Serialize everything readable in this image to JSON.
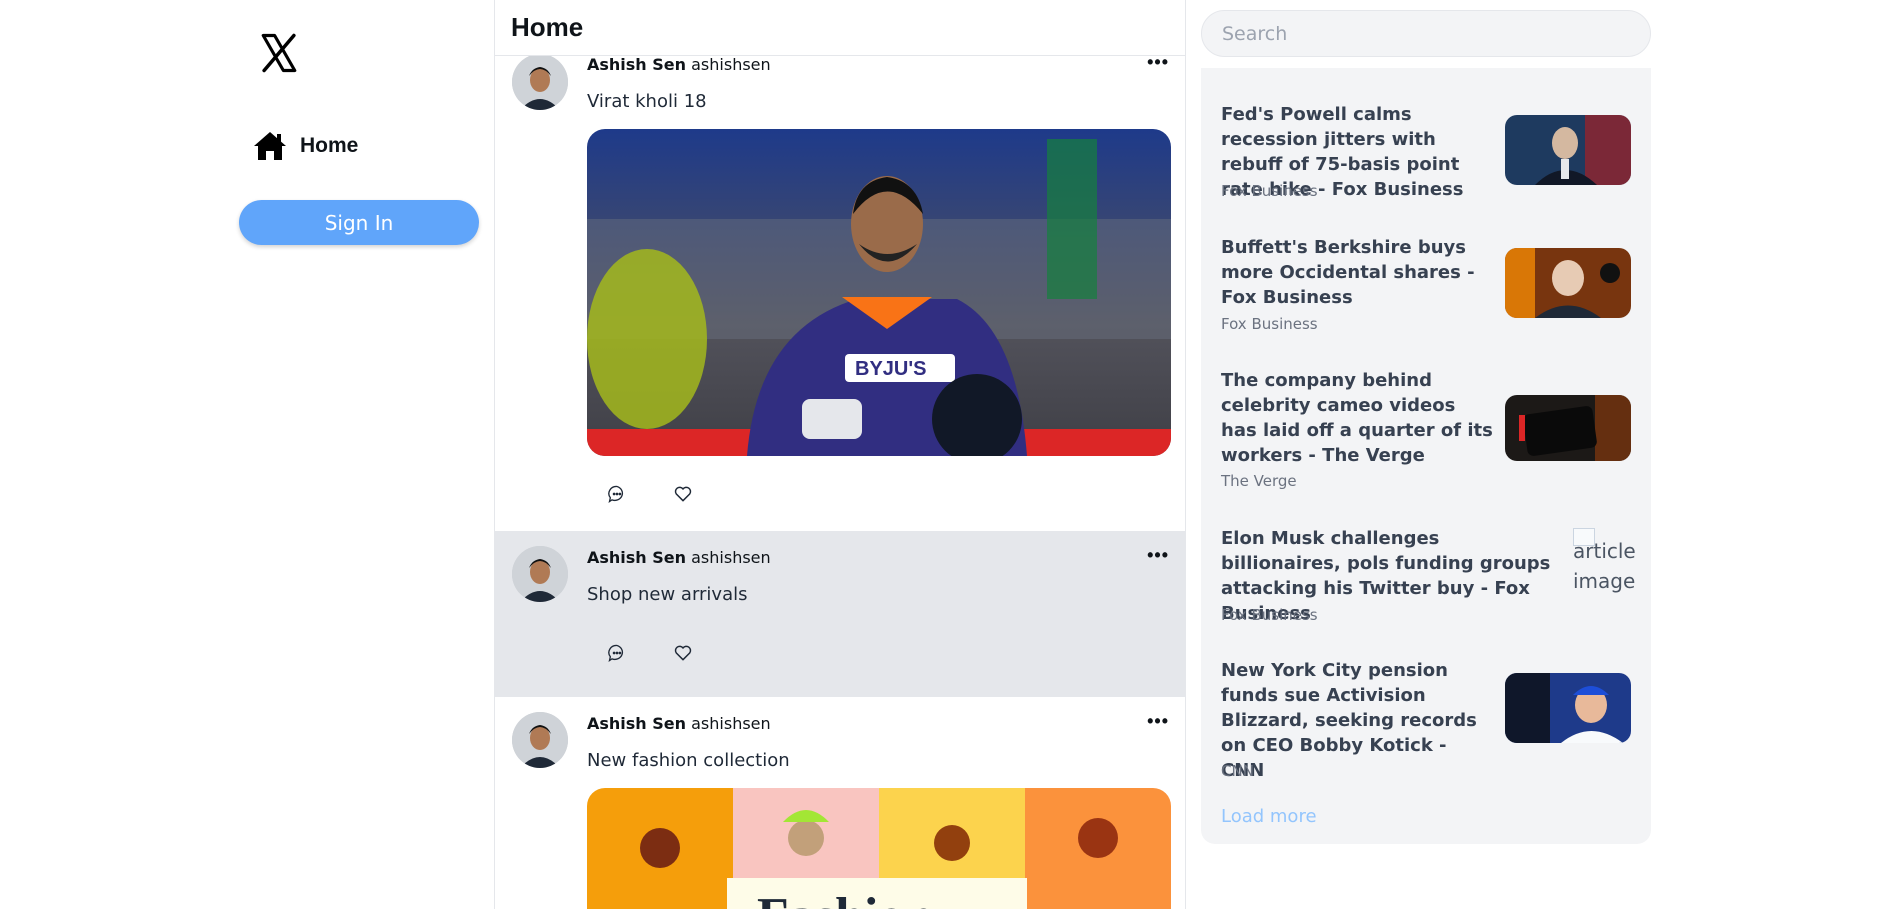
{
  "sidebar": {
    "logo_icon": "x-logo-icon",
    "home_label": "Home",
    "home_icon": "home-icon",
    "signin_label": "Sign In"
  },
  "feed": {
    "title": "Home",
    "tweets": [
      {
        "name": "Ashish Sen",
        "handle": "ashishsen",
        "text": "Virat kholi 18",
        "has_image": true,
        "image": "cricketer-photo"
      },
      {
        "name": "Ashish Sen",
        "handle": "ashishsen",
        "text": "Shop new arrivals",
        "has_image": false
      },
      {
        "name": "Ashish Sen",
        "handle": "ashishsen",
        "text": "New fashion collection",
        "has_image": true,
        "image": "fashion-collage",
        "image_text": "Fashion"
      }
    ],
    "more_label": "•••",
    "actions": [
      "comment-icon",
      "heart-icon"
    ]
  },
  "search": {
    "placeholder": "Search"
  },
  "news": {
    "articles": [
      {
        "headline": "Fed's Powell calms recession jitters with rebuff of 75-basis point rate hike - Fox Business",
        "source": "Fox Business"
      },
      {
        "headline": "Buffett's Berkshire buys more Occidental shares - Fox Business",
        "source": "Fox Business"
      },
      {
        "headline": "The company behind celebrity cameo videos has laid off a quarter of its workers - The Verge",
        "source": "The Verge"
      },
      {
        "headline": "Elon Musk challenges billionaires, pols funding groups attacking his Twitter buy - Fox Business",
        "source": "Fox Business",
        "image_alt": "article image"
      },
      {
        "headline": "New York City pension funds sue Activision Blizzard, seeking records on CEO Bobby Kotick - CNN",
        "source": "CNN"
      }
    ],
    "load_more": "Load more"
  },
  "colors": {
    "accent": "#60a5fa",
    "load_more": "#93c5fd",
    "panel": "#f3f4f6",
    "highlight_row": "#e5e7eb"
  }
}
